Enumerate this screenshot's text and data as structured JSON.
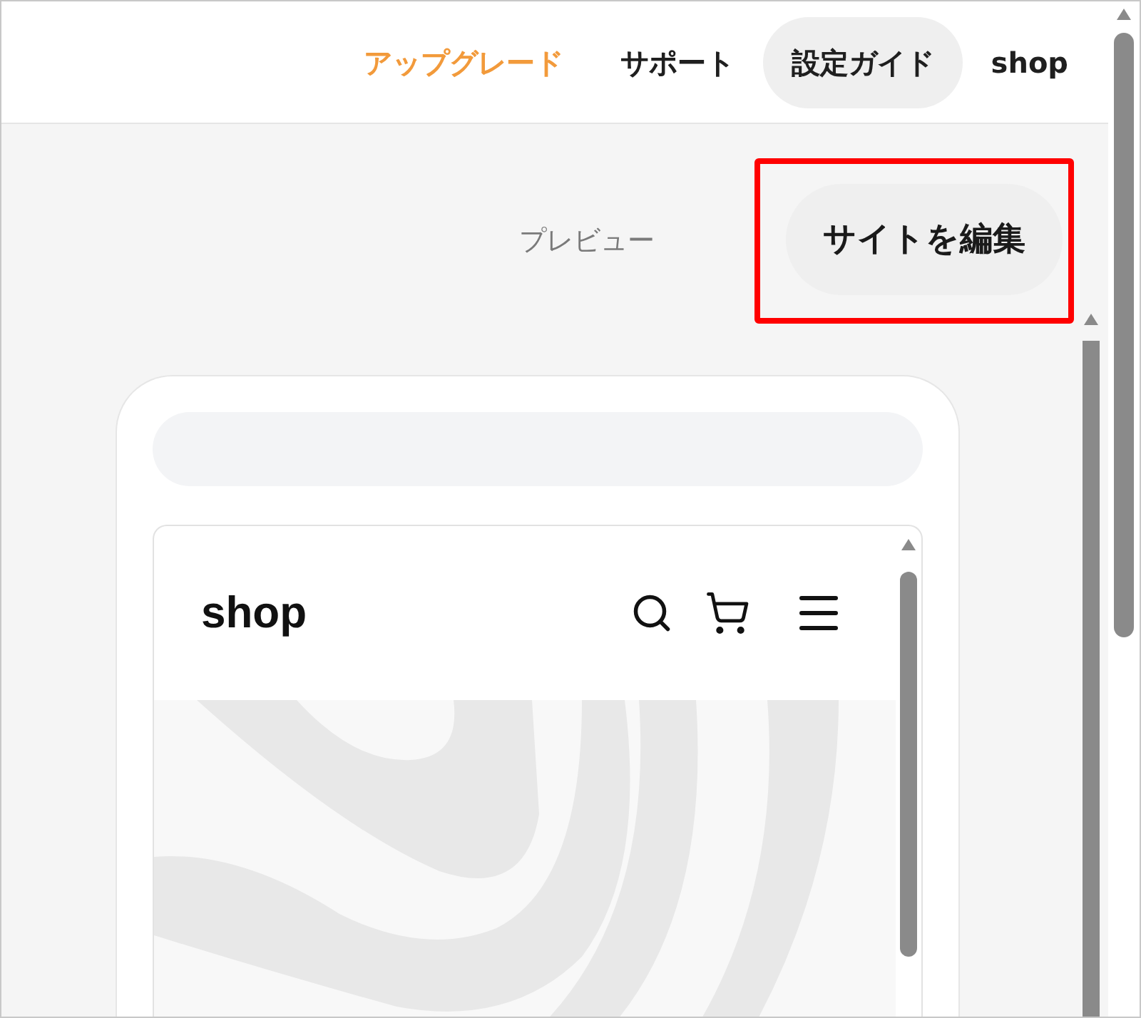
{
  "nav": [
    {
      "label": "アップグレード",
      "kind": "upgrade",
      "selected": false
    },
    {
      "label": "サポート",
      "kind": "link",
      "selected": false
    },
    {
      "label": "設定ガイド",
      "kind": "link",
      "selected": true
    },
    {
      "label": "shop",
      "kind": "link",
      "selected": false
    }
  ],
  "toolbar": {
    "preview": "プレビュー",
    "edit_button": {
      "label": "サイトを編集",
      "highlighted": true
    }
  },
  "site_preview": {
    "logo": "shop"
  }
}
